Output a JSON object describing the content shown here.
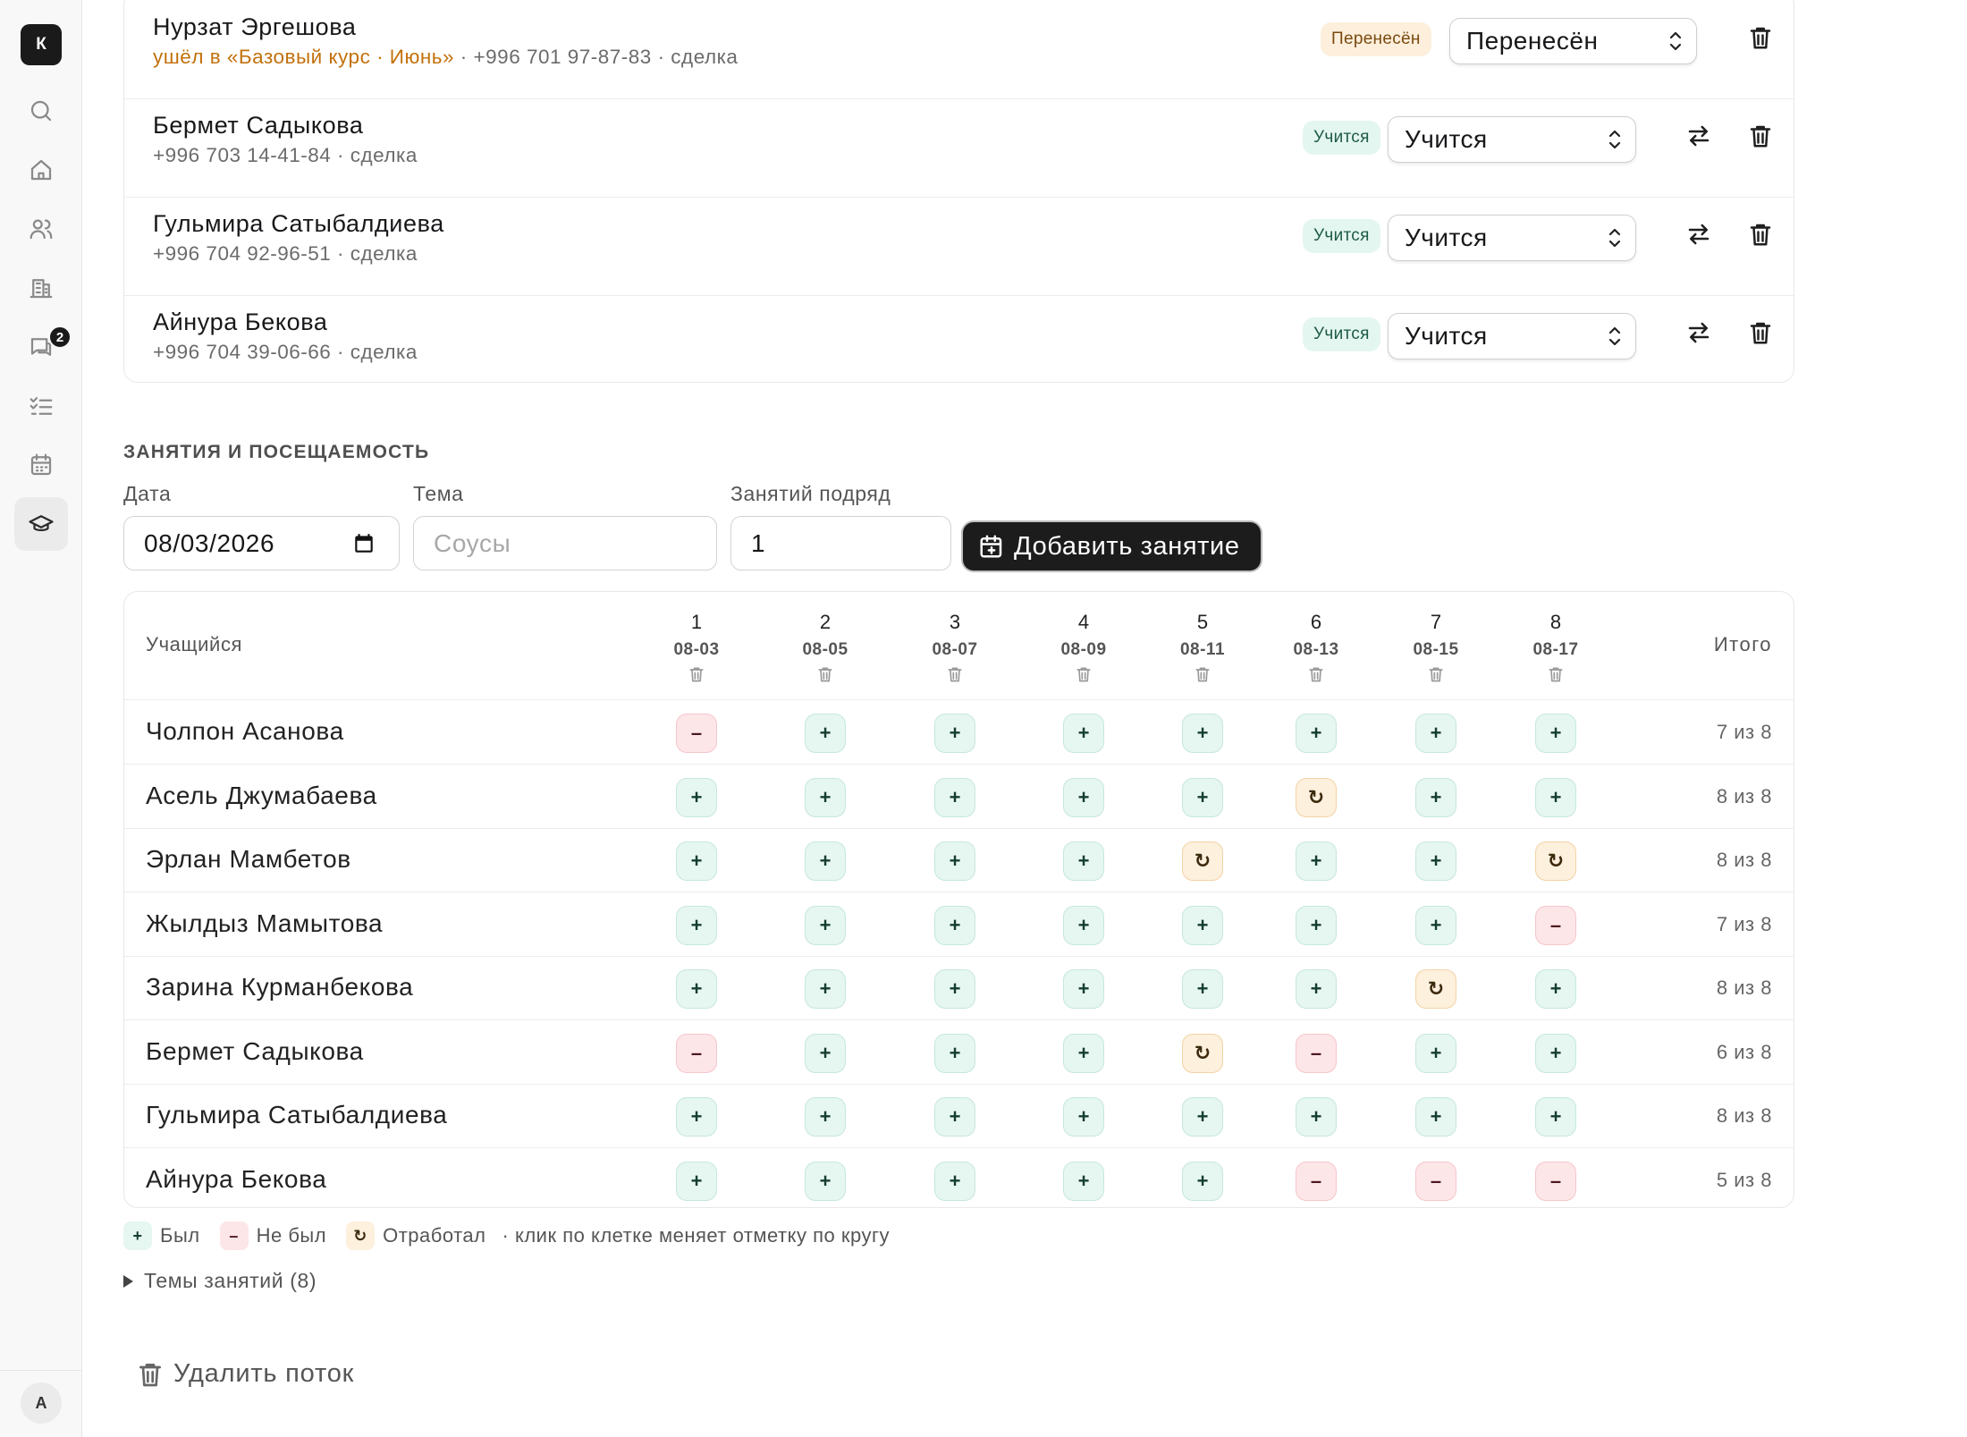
{
  "sidebar": {
    "brand": "К",
    "items": [
      {
        "icon": "search-icon"
      },
      {
        "icon": "home-icon"
      },
      {
        "icon": "users-icon"
      },
      {
        "icon": "building-icon"
      },
      {
        "icon": "chat-icon",
        "badge": "2"
      },
      {
        "icon": "checklist-icon"
      },
      {
        "icon": "calendar-icon"
      },
      {
        "icon": "graduation-cap-icon",
        "active": true
      }
    ],
    "user_initial": "А"
  },
  "students": [
    {
      "name": "Нурзат Эргешова",
      "moved_note": "ушёл в «Базовый курс · Июнь»",
      "meta": " · +996 701 97-87-83 · сделка",
      "status_badge": "Перенесён",
      "status_select": "Перенесён",
      "badge_type": "moved",
      "has_transfer": false
    },
    {
      "name": "Бермет Садыкова",
      "moved_note": "",
      "meta": "+996 703 14-41-84 · сделка",
      "status_badge": "Учится",
      "status_select": "Учится",
      "badge_type": "study",
      "has_transfer": true
    },
    {
      "name": "Гульмира Сатыбалдиева",
      "moved_note": "",
      "meta": "+996 704 92-96-51 · сделка",
      "status_badge": "Учится",
      "status_select": "Учится",
      "badge_type": "study",
      "has_transfer": true
    },
    {
      "name": "Айнура Бекова",
      "moved_note": "",
      "meta": "+996 704 39-06-66 · сделка",
      "status_badge": "Учится",
      "status_select": "Учится",
      "badge_type": "study",
      "has_transfer": true
    }
  ],
  "lessons": {
    "section_title": "ЗАНЯТИЯ И ПОСЕЩАЕМОСТЬ",
    "date_label": "Дата",
    "date_value": "08/03/2026",
    "topic_label": "Тема",
    "topic_placeholder": "Соусы",
    "count_label": "Занятий подряд",
    "count_value": "1",
    "add_button": "Добавить занятие"
  },
  "attendance": {
    "student_header": "Учащийся",
    "total_header": "Итого",
    "columns": [
      {
        "num": "1",
        "date": "08-03"
      },
      {
        "num": "2",
        "date": "08-05"
      },
      {
        "num": "3",
        "date": "08-07"
      },
      {
        "num": "4",
        "date": "08-09"
      },
      {
        "num": "5",
        "date": "08-11"
      },
      {
        "num": "6",
        "date": "08-13"
      },
      {
        "num": "7",
        "date": "08-15"
      },
      {
        "num": "8",
        "date": "08-17"
      }
    ],
    "rows": [
      {
        "name": "Чолпон Асанова",
        "marks": [
          "a",
          "p",
          "p",
          "p",
          "p",
          "p",
          "p",
          "p"
        ],
        "total": "7 из 8"
      },
      {
        "name": "Асель Джумабаева",
        "marks": [
          "p",
          "p",
          "p",
          "p",
          "p",
          "m",
          "p",
          "p"
        ],
        "total": "8 из 8"
      },
      {
        "name": "Эрлан Мамбетов",
        "marks": [
          "p",
          "p",
          "p",
          "p",
          "m",
          "p",
          "p",
          "m"
        ],
        "total": "8 из 8"
      },
      {
        "name": "Жылдыз Мамытова",
        "marks": [
          "p",
          "p",
          "p",
          "p",
          "p",
          "p",
          "p",
          "a"
        ],
        "total": "7 из 8"
      },
      {
        "name": "Зарина Курманбекова",
        "marks": [
          "p",
          "p",
          "p",
          "p",
          "p",
          "p",
          "m",
          "p"
        ],
        "total": "8 из 8"
      },
      {
        "name": "Бермет Садыкова",
        "marks": [
          "a",
          "p",
          "p",
          "p",
          "m",
          "a",
          "p",
          "p"
        ],
        "total": "6 из 8"
      },
      {
        "name": "Гульмира Сатыбалдиева",
        "marks": [
          "p",
          "p",
          "p",
          "p",
          "p",
          "p",
          "p",
          "p"
        ],
        "total": "8 из 8"
      },
      {
        "name": "Айнура Бекова",
        "marks": [
          "p",
          "p",
          "p",
          "p",
          "p",
          "a",
          "a",
          "a"
        ],
        "total": "5 из 8"
      }
    ],
    "mark_symbols": {
      "p": "+",
      "a": "–",
      "m": "↻"
    }
  },
  "legend": {
    "present": "Был",
    "absent": "Не был",
    "makeup": "Отработал",
    "hint": "· клик по клетке меняет отметку по кругу"
  },
  "topics_toggle": "Темы занятий (8)",
  "delete_stream": "Удалить поток"
}
